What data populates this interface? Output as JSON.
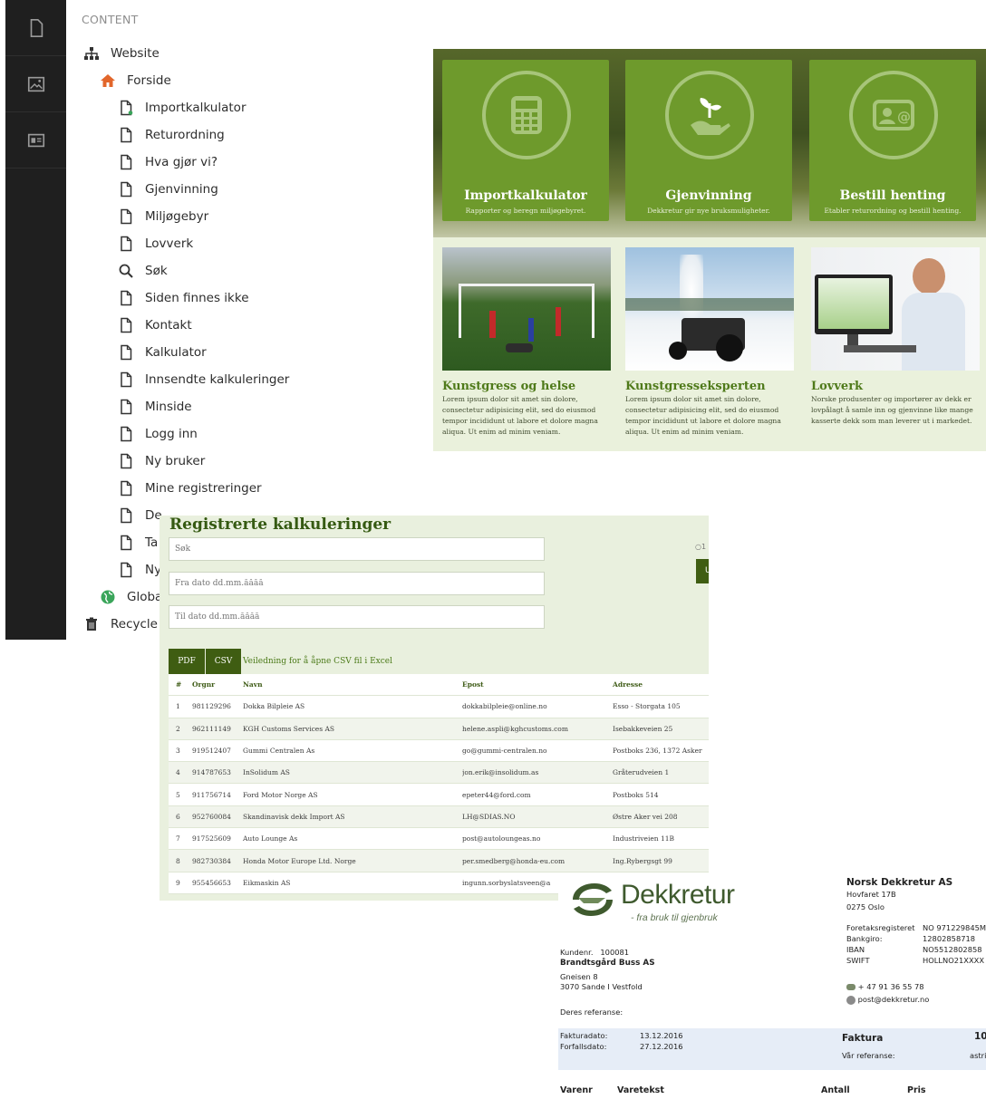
{
  "cms": {
    "section_header": "CONTENT",
    "tree": [
      {
        "label": "Website",
        "level": 0,
        "icon": "sitemap-icon"
      },
      {
        "label": "Forside",
        "level": 1,
        "icon": "home-icon"
      },
      {
        "label": "Importkalkulator",
        "level": 2,
        "icon": "page-icon"
      },
      {
        "label": "Returordning",
        "level": 2,
        "icon": "page-icon"
      },
      {
        "label": "Hva gjør vi?",
        "level": 2,
        "icon": "page-icon"
      },
      {
        "label": "Gjenvinning",
        "level": 2,
        "icon": "page-icon"
      },
      {
        "label": "Miljøgebyr",
        "level": 2,
        "icon": "page-icon"
      },
      {
        "label": "Lovverk",
        "level": 2,
        "icon": "page-icon"
      },
      {
        "label": "Søk",
        "level": 2,
        "icon": "search-icon"
      },
      {
        "label": "Siden finnes ikke",
        "level": 2,
        "icon": "page-icon"
      },
      {
        "label": "Kontakt",
        "level": 2,
        "icon": "page-icon"
      },
      {
        "label": "Kalkulator",
        "level": 2,
        "icon": "page-icon"
      },
      {
        "label": "Innsendte kalkuleringer",
        "level": 2,
        "icon": "page-icon"
      },
      {
        "label": "Minside",
        "level": 2,
        "icon": "page-icon"
      },
      {
        "label": "Logg inn",
        "level": 2,
        "icon": "page-icon"
      },
      {
        "label": "Ny bruker",
        "level": 2,
        "icon": "page-icon"
      },
      {
        "label": "Mine registreringer",
        "level": 2,
        "icon": "page-icon"
      },
      {
        "label": "De",
        "level": 2,
        "icon": "page-icon"
      },
      {
        "label": "Ta",
        "level": 2,
        "icon": "page-icon"
      },
      {
        "label": "Ny",
        "level": 2,
        "icon": "page-icon"
      },
      {
        "label": "Globa",
        "level": 1,
        "icon": "globe-icon"
      },
      {
        "label": "Recycle I",
        "level": 0,
        "icon": "trash-icon"
      }
    ]
  },
  "site": {
    "tiles": [
      {
        "title": "Importkalkulator",
        "subtitle": "Rapporter og beregn miljøgebyret.",
        "icon": "calculator-icon"
      },
      {
        "title": "Gjenvinning",
        "subtitle": "Dekkretur gir nye bruksmuligheter.",
        "icon": "plant-hand-icon"
      },
      {
        "title": "Bestill henting",
        "subtitle": "Etabler returordning og bestill henting.",
        "icon": "contact-card-icon"
      }
    ],
    "cards": [
      {
        "title": "Kunstgress og helse",
        "text": "Lorem ipsum dolor sit amet sin dolore, consectetur adipisicing elit, sed do eiusmod tempor incididunt ut labore et dolore magna aliqua. Ut enim ad minim veniam."
      },
      {
        "title": "Kunstgresseksperten",
        "text": "Lorem ipsum dolor sit amet sin dolore, consectetur adipisicing elit, sed do eiusmod tempor incididunt ut labore et dolore magna aliqua. Ut enim ad minim veniam."
      },
      {
        "title": "Lovverk",
        "text": "Norske produsenter og importører av dekk er lovpålagt å samle inn og gjenvinne like mange kasserte dekk som man leverer ut i markedet."
      }
    ]
  },
  "registry": {
    "title": "Registrerte kalkuleringer",
    "search_placeholder": "Søk",
    "from_placeholder": "Fra dato dd.mm.åååå",
    "to_placeholder": "Til dato dd.mm.åååå",
    "radio_label": "1",
    "side_button": "U",
    "pdf_label": "PDF",
    "csv_label": "CSV",
    "csv_help": "Veiledning for å åpne CSV fil i Excel",
    "columns": [
      "#",
      "Orgnr",
      "Navn",
      "Epost",
      "Adresse"
    ],
    "rows": [
      [
        "1",
        "981129296",
        "Dokka Bilpleie AS",
        "dokkabilpleie@online.no",
        "Esso - Storgata 105"
      ],
      [
        "2",
        "962111149",
        "KGH Customs Services AS",
        "helene.aspli@kghcustoms.com",
        "Isebakkeveien 25"
      ],
      [
        "3",
        "919512407",
        "Gummi Centralen As",
        "go@gummi-centralen.no",
        "Postboks 236, 1372 Asker"
      ],
      [
        "4",
        "914787653",
        "InSolidum AS",
        "jon.erik@insolidum.as",
        "Gråterudveien 1"
      ],
      [
        "5",
        "911756714",
        "Ford Motor Norge AS",
        "epeter44@ford.com",
        "Postboks 514"
      ],
      [
        "6",
        "952760084",
        "Skandinavisk dekk Import AS",
        "LH@SDIAS.NO",
        "Østre Aker vei 208"
      ],
      [
        "7",
        "917525609",
        "Auto Lounge As",
        "post@autoloungeas.no",
        "Industriveien 11B"
      ],
      [
        "8",
        "982730384",
        "Honda Motor Europe Ltd. Norge",
        "per.smedberg@honda-eu.com",
        "Ing.Rybergsgt 99"
      ],
      [
        "9",
        "955456653",
        "Eikmaskin AS",
        "ingunn.sorbyslatsveen@a",
        ""
      ]
    ]
  },
  "invoice": {
    "brand": "Dekkretur",
    "tagline": "- fra bruk til gjenbruk",
    "customer_no_label": "Kundenr.",
    "customer_no": "100081",
    "customer_name": "Brandtsgård Buss AS",
    "customer_street": "Gneisen 8",
    "customer_city": "3070  Sande I Vestfold",
    "reference_label": "Deres referanse:",
    "invoice_date_label": "Fakturadato:",
    "invoice_date": "13.12.2016",
    "due_date_label": "Forfallsdato:",
    "due_date": "27.12.2016",
    "company_name": "Norsk Dekkretur AS",
    "company_street": "Hovfaret 17B",
    "company_city": "0275     Oslo",
    "org_label": "Foretaksregisteret",
    "org_value": "NO 971229845M",
    "bank_label": "Bankgiro:",
    "bank_value": "12802858718",
    "iban_label": "IBAN",
    "iban_value": "NO5512802858",
    "swift_label": "SWIFT",
    "swift_value": "HOLLNO21XXXX",
    "phone": "+ 47 91 36 55 78",
    "email": "post@dekkretur.no",
    "doc_type": "Faktura",
    "doc_no": "10",
    "our_ref_label": "Vår referanse:",
    "our_ref": "astri",
    "col_item_no": "Varenr",
    "col_item_text": "Varetekst",
    "col_qty": "Antall",
    "col_price": "Pris"
  }
}
